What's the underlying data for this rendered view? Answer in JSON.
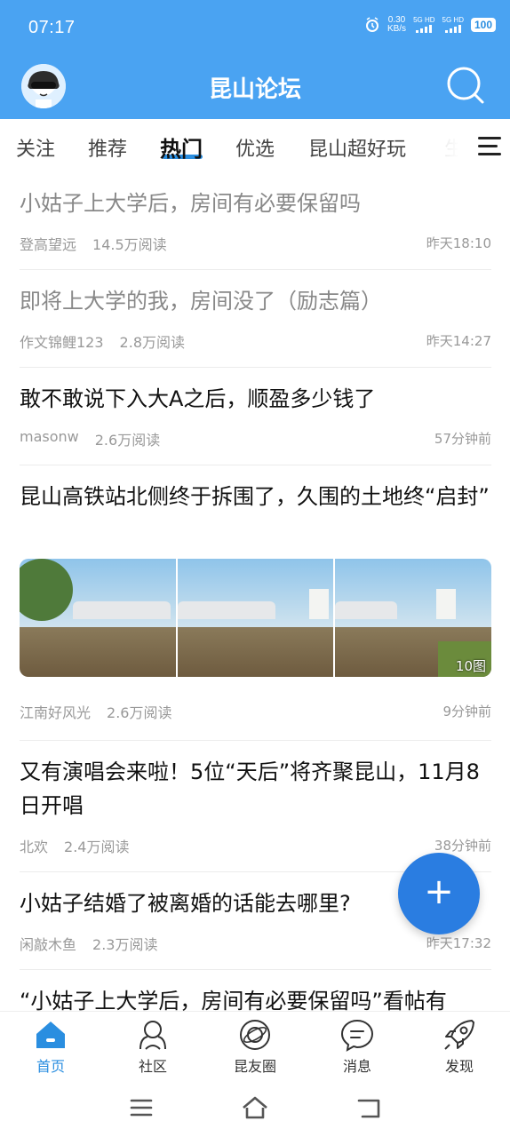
{
  "status": {
    "time": "07:17",
    "speed_value": "0.30",
    "speed_unit": "KB/s",
    "sig1": "5G HD",
    "sig2": "5G HD",
    "battery": "100"
  },
  "header": {
    "title": "昆山论坛"
  },
  "tabs": [
    {
      "label": "关注"
    },
    {
      "label": "推荐"
    },
    {
      "label": "热门"
    },
    {
      "label": "优选"
    },
    {
      "label": "昆山超好玩"
    },
    {
      "label": "生"
    }
  ],
  "posts": [
    {
      "title": "小姑子上大学后，房间有必要保留吗",
      "author": "登高望远",
      "reads": "14.5万阅读",
      "time": "昨天18:10",
      "read": true
    },
    {
      "title": "即将上大学的我，房间没了（励志篇）",
      "author": "作文锦鲤123",
      "reads": "2.8万阅读",
      "time": "昨天14:27",
      "read": true
    },
    {
      "title": "敢不敢说下入大A之后，顺盈多少钱了",
      "author": "masonw",
      "reads": "2.6万阅读",
      "time": "57分钟前",
      "read": false
    },
    {
      "title": "昆山高铁站北侧终于拆围了，久围的土地终“启封”",
      "author": "江南好风光",
      "reads": "2.6万阅读",
      "time": "9分钟前",
      "read": false,
      "image_count": "10图"
    },
    {
      "title": "又有演唱会来啦！5位“天后”将齐聚昆山，11月8日开唱",
      "author": "北欢",
      "reads": "2.4万阅读",
      "time": "38分钟前",
      "read": false
    },
    {
      "title": "小姑子结婚了被离婚的话能去哪里?",
      "author": "闲敲木鱼",
      "reads": "2.3万阅读",
      "time": "昨天17:32",
      "read": false
    },
    {
      "title": "“小姑子上大学后，房间有必要保留吗”看帖有",
      "read": false
    }
  ],
  "fab": {
    "label": "+"
  },
  "bottom_nav": [
    {
      "label": "首页",
      "icon": "home-icon"
    },
    {
      "label": "社区",
      "icon": "community-icon"
    },
    {
      "label": "昆友圈",
      "icon": "planet-icon"
    },
    {
      "label": "消息",
      "icon": "message-icon"
    },
    {
      "label": "发现",
      "icon": "rocket-icon"
    }
  ],
  "colors": {
    "brand": "#4aa3f2",
    "accent": "#2a8ee0",
    "fab": "#2a7de1"
  }
}
